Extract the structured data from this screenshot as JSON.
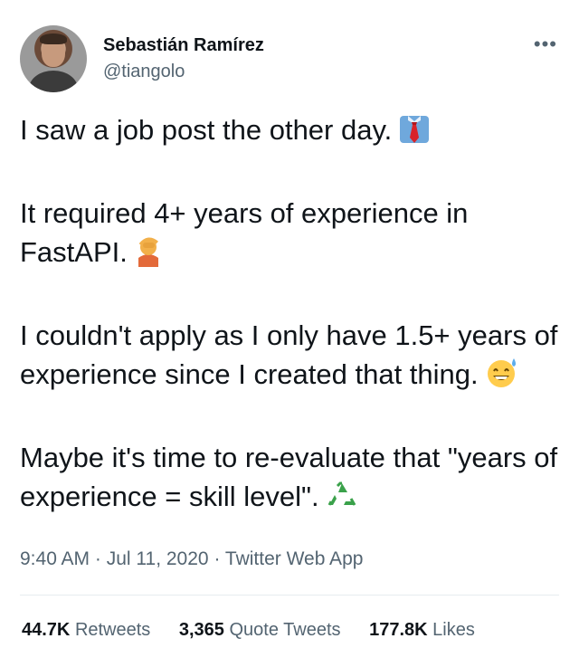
{
  "author": {
    "display_name": "Sebastián Ramírez",
    "handle": "@tiangolo"
  },
  "menu": {
    "more_label": "•••"
  },
  "tweet": {
    "lines": [
      "I saw a job post the other day.",
      "It required 4+ years of experience in FastAPI.",
      "I couldn't apply as I only have 1.5+ years of experience since I created that thing.",
      "Maybe it's time to re-evaluate that \"years of experience = skill level\"."
    ],
    "emojis": [
      "necktie",
      "person-facepalming",
      "grinning-face-with-sweat",
      "recycling-symbol"
    ]
  },
  "meta": {
    "time": "9:40 AM",
    "separator": " · ",
    "date": "Jul 11, 2020",
    "source": "Twitter Web App"
  },
  "stats": {
    "retweets_count": "44.7K",
    "retweets_label": "Retweets",
    "quotes_count": "3,365",
    "quotes_label": "Quote Tweets",
    "likes_count": "177.8K",
    "likes_label": "Likes"
  },
  "colors": {
    "text": "#0f1419",
    "secondary": "#536471",
    "divider": "#e6ecf0",
    "tie": "#d8232a",
    "shirt": "#6fa8dc",
    "recycle": "#3aa14a"
  }
}
